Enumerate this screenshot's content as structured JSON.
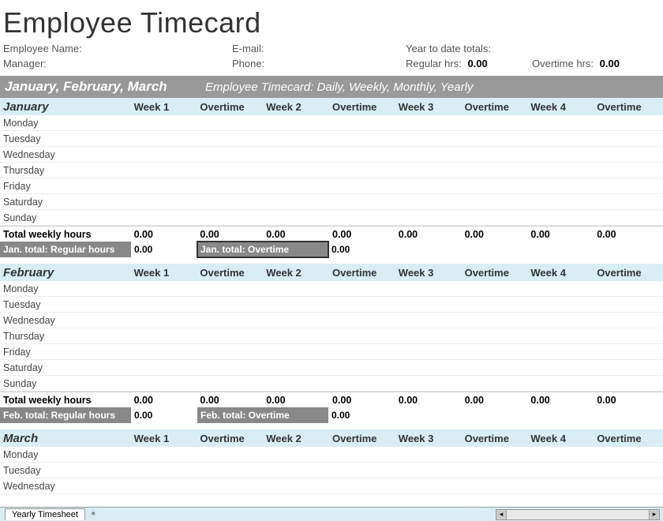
{
  "title": "Employee Timecard",
  "info": {
    "employee_name_label": "Employee Name:",
    "email_label": "E-mail:",
    "ytd_label": "Year to date totals:",
    "manager_label": "Manager:",
    "phone_label": "Phone:",
    "regular_hrs_label": "Regular hrs:",
    "regular_hrs_value": "0.00",
    "overtime_hrs_label": "Overtime hrs:",
    "overtime_hrs_value": "0.00"
  },
  "quarter": {
    "title": "January, February, March",
    "subtitle": "Employee Timecard: Daily, Weekly, Monthly, Yearly"
  },
  "columns": [
    "Week 1",
    "Overtime",
    "Week 2",
    "Overtime",
    "Week 3",
    "Overtime",
    "Week 4",
    "Overtime"
  ],
  "days": [
    "Monday",
    "Tuesday",
    "Wednesday",
    "Thursday",
    "Friday",
    "Saturday",
    "Sunday"
  ],
  "months": {
    "jan": {
      "name": "January",
      "totals_label": "Total weekly hours",
      "totals": [
        "0.00",
        "0.00",
        "0.00",
        "0.00",
        "0.00",
        "0.00",
        "0.00",
        "0.00"
      ],
      "summary_reg_label": "Jan. total: Regular hours",
      "summary_reg_value": "0.00",
      "summary_ot_label": "Jan. total: Overtime",
      "summary_ot_value": "0.00"
    },
    "feb": {
      "name": "February",
      "totals_label": "Total weekly hours",
      "totals": [
        "0.00",
        "0.00",
        "0.00",
        "0.00",
        "0.00",
        "0.00",
        "0.00",
        "0.00"
      ],
      "summary_reg_label": "Feb. total: Regular hours",
      "summary_reg_value": "0.00",
      "summary_ot_label": "Feb.  total: Overtime",
      "summary_ot_value": "0.00"
    },
    "mar": {
      "name": "March",
      "days_visible": [
        "Monday",
        "Tuesday",
        "Wednesday"
      ]
    }
  },
  "sheet_tab": "Yearly Timesheet"
}
